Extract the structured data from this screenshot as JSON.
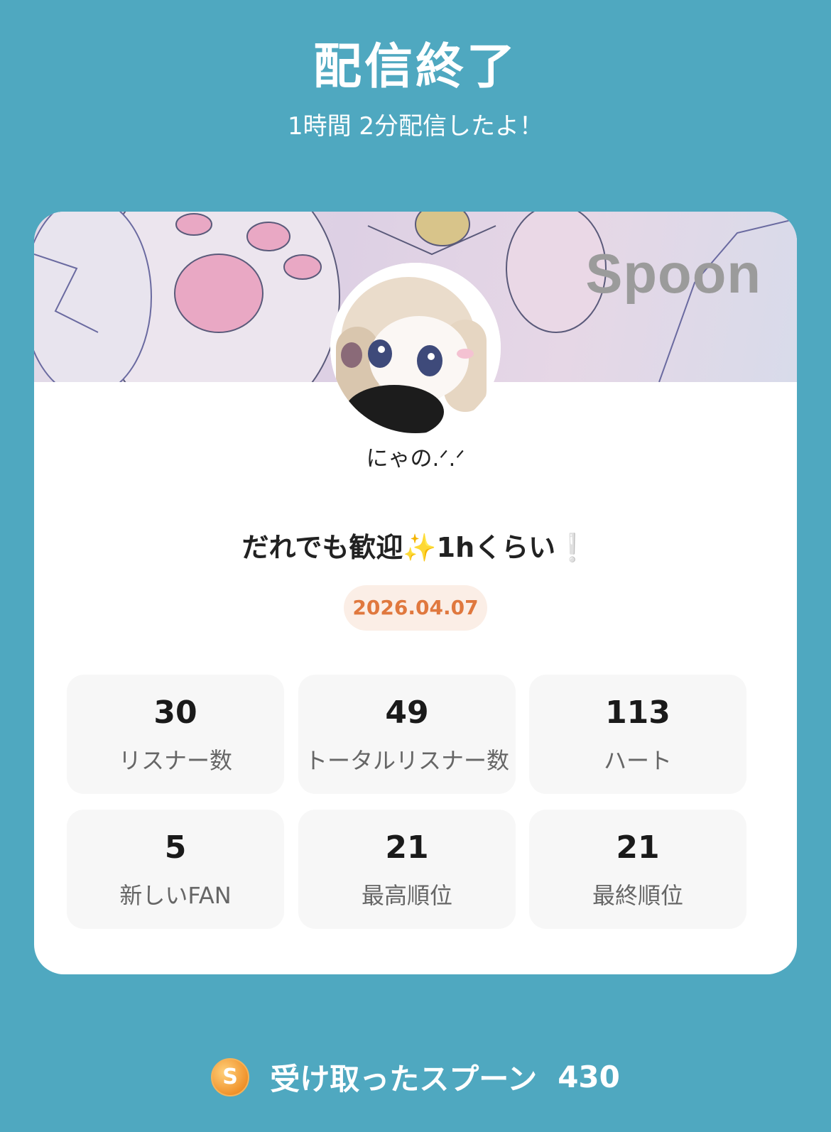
{
  "header": {
    "title": "配信終了",
    "subtitle": "1時間 2分配信したよ！"
  },
  "card": {
    "brand": "Spoon",
    "username": "にゃの.ᐟ.ᐟ",
    "live_title": "だれでも歓迎✨1hくらい❕",
    "date": "2026.04.07",
    "stats": [
      {
        "value": "30",
        "label": "リスナー数"
      },
      {
        "value": "49",
        "label": "トータルリスナー数"
      },
      {
        "value": "113",
        "label": "ハート"
      },
      {
        "value": "5",
        "label": "新しいFAN"
      },
      {
        "value": "21",
        "label": "最高順位"
      },
      {
        "value": "21",
        "label": "最終順位"
      }
    ]
  },
  "footer": {
    "coin_letter": "S",
    "label": "受け取ったスプーン",
    "count": "430"
  }
}
